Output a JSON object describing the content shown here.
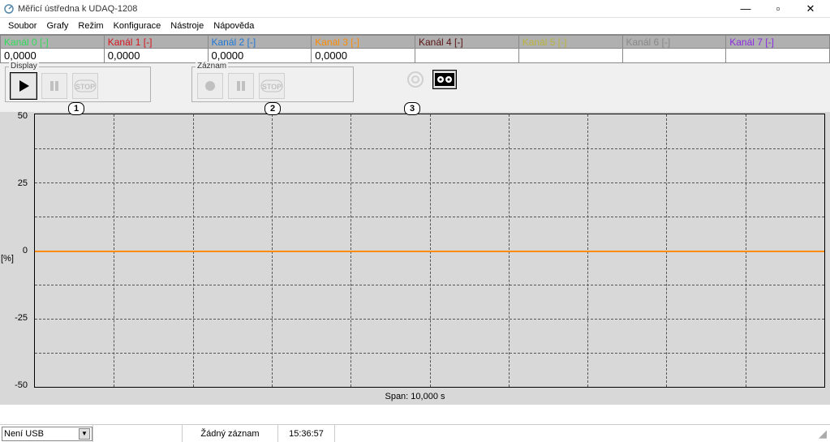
{
  "window": {
    "title": "Měřicí ústředna k UDAQ-1208",
    "minimize": "—",
    "maximize": "▫",
    "close": "✕"
  },
  "menu": [
    "Soubor",
    "Grafy",
    "Režim",
    "Konfigurace",
    "Nástroje",
    "Nápověda"
  ],
  "channels": [
    {
      "label": "Kanál 0 [-]",
      "color": "#2fdc5a",
      "value": "0,0000"
    },
    {
      "label": "Kanál 1 [-]",
      "color": "#d8141e",
      "value": "0,0000"
    },
    {
      "label": "Kanál 2 [-]",
      "color": "#1e78d8",
      "value": "0,0000"
    },
    {
      "label": "Kanál 3 [-]",
      "color": "#ff8c00",
      "value": "0,0000"
    },
    {
      "label": "Kanál 4 [-]",
      "color": "#5a1414",
      "value": ""
    },
    {
      "label": "Kanál 5 [-]",
      "color": "#b9b43c",
      "value": ""
    },
    {
      "label": "Kanál 6 [-]",
      "color": "#888888",
      "value": ""
    },
    {
      "label": "Kanál 7 [-]",
      "color": "#8a2be2",
      "value": ""
    }
  ],
  "groups": {
    "display": "Display",
    "record": "Záznam"
  },
  "callouts": [
    "1",
    "2",
    "3"
  ],
  "chart_data": {
    "type": "line",
    "ylabel": "[%]",
    "ylim": [
      -50,
      50
    ],
    "y_ticks": [
      50,
      25,
      0,
      -25,
      -50
    ],
    "x_span_label": "Span: 10,000 s",
    "series": [
      {
        "name": "Kanál 3",
        "color": "#ff8c00",
        "values": [
          0,
          0,
          0,
          0,
          0,
          0,
          0,
          0,
          0,
          0,
          0
        ]
      }
    ]
  },
  "status": {
    "connection": "Není USB",
    "record_state": "Žádný záznam",
    "time": "15:36:57"
  }
}
